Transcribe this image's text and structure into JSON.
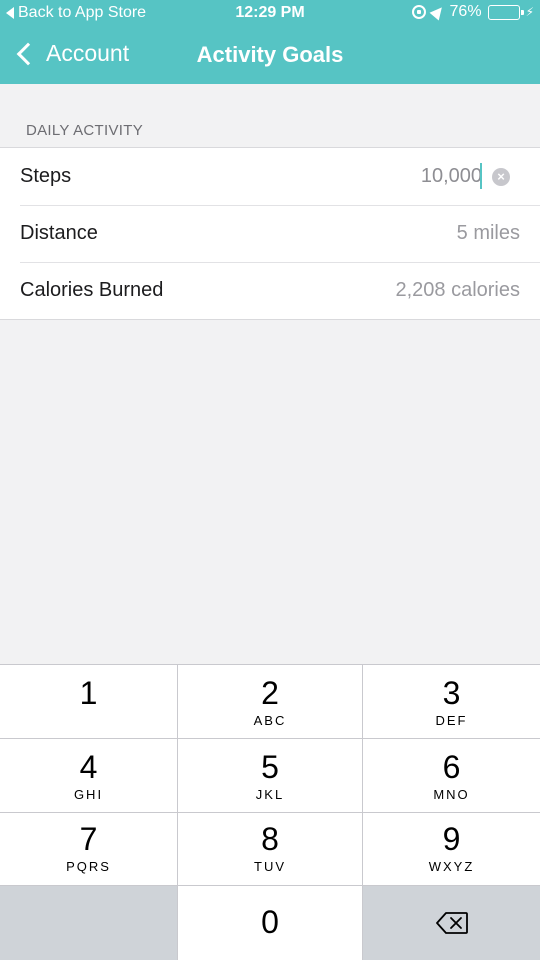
{
  "status": {
    "back_label": "Back to App Store",
    "time": "12:29 PM",
    "battery": "76%",
    "battery_level": 0.76
  },
  "nav": {
    "back_label": "Account",
    "title": "Activity Goals",
    "accent_color": "#56c4c4"
  },
  "section": {
    "header": "DAILY ACTIVITY",
    "rows": [
      {
        "label": "Steps",
        "value": "10,000"
      },
      {
        "label": "Distance",
        "value": "5 miles"
      },
      {
        "label": "Calories Burned",
        "value": "2,208 calories"
      }
    ]
  },
  "keypad": {
    "keys": [
      {
        "digit": "1",
        "letters": ""
      },
      {
        "digit": "2",
        "letters": "ABC"
      },
      {
        "digit": "3",
        "letters": "DEF"
      },
      {
        "digit": "4",
        "letters": "GHI"
      },
      {
        "digit": "5",
        "letters": "JKL"
      },
      {
        "digit": "6",
        "letters": "MNO"
      },
      {
        "digit": "7",
        "letters": "PQRS"
      },
      {
        "digit": "8",
        "letters": "TUV"
      },
      {
        "digit": "9",
        "letters": "WXYZ"
      },
      {
        "digit": "0",
        "letters": ""
      }
    ],
    "delete_icon": "backspace-icon"
  }
}
